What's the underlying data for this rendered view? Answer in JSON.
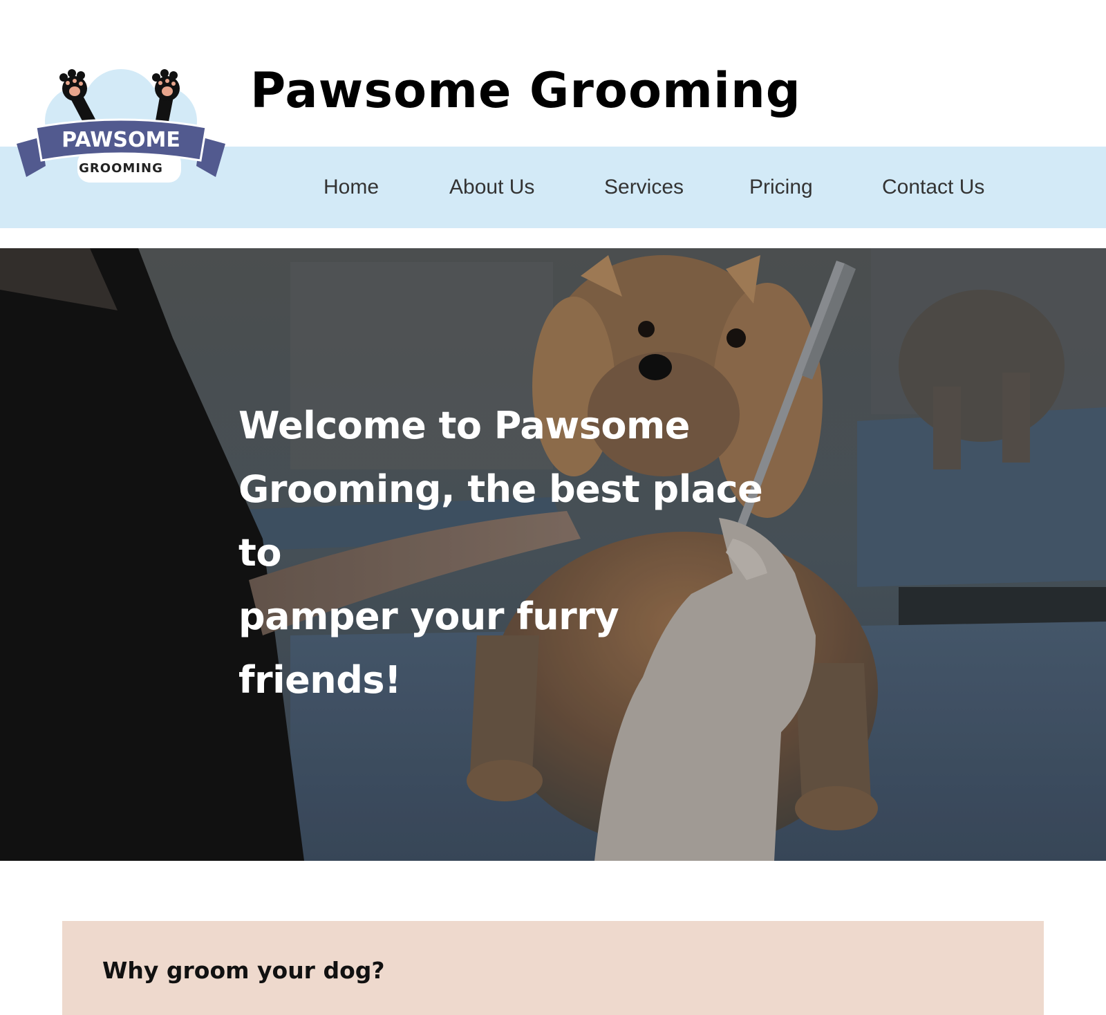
{
  "site": {
    "title": "Pawsome Grooming",
    "logo_text_top": "PAWSOME",
    "logo_text_bottom": "GROOMING"
  },
  "nav": {
    "items": [
      {
        "label": "Home"
      },
      {
        "label": "About Us"
      },
      {
        "label": "Services"
      },
      {
        "label": "Pricing"
      },
      {
        "label": "Contact Us"
      }
    ]
  },
  "hero": {
    "heading_lines": [
      "Welcome to Pawsome",
      "Grooming, the best place to",
      "pamper your furry friends!"
    ]
  },
  "info": {
    "heading": "Why groom your dog?"
  },
  "colors": {
    "nav_band": "#d3eaf7",
    "logo_ribbon": "#525a8f",
    "info_card": "#eed9cd"
  }
}
